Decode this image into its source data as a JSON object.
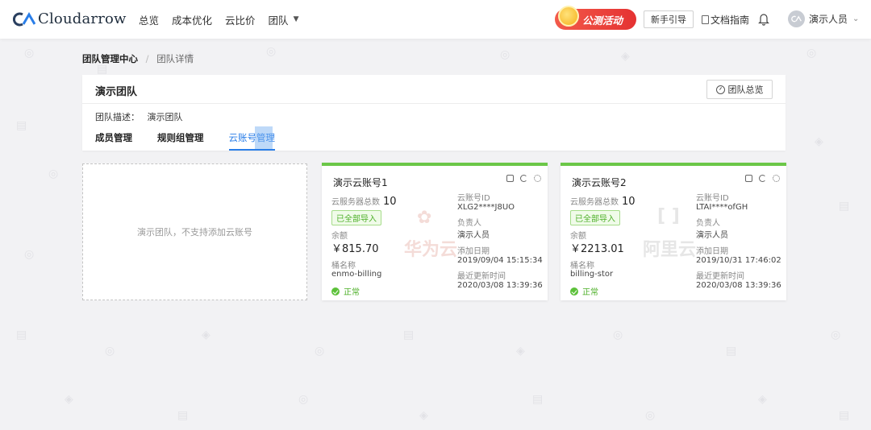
{
  "brand": {
    "name": "Cloudarrow",
    "accent": "#2a7ee8",
    "green": "#6bc748"
  },
  "nav": {
    "items": [
      "总览",
      "成本优化",
      "云比价",
      "团队"
    ]
  },
  "header": {
    "promo_label": "公测活动",
    "guide_label": "新手引导",
    "docs_label": "文档指南",
    "user_name": "演示人员"
  },
  "breadcrumb": {
    "root": "团队管理中心",
    "separator": "/",
    "current": "团队详情"
  },
  "team": {
    "name": "演示团队",
    "overview_label": "团队总览",
    "desc_label": "团队描述：",
    "desc_value": "演示团队",
    "tabs": [
      "成员管理",
      "规则组管理",
      "云账号管理"
    ],
    "active_tab": "云账号管理"
  },
  "add_account": {
    "message": "演示团队，不支持添加云账号"
  },
  "labels": {
    "server_count": "云服务器总数",
    "balance": "余额",
    "bucket": "桶名称",
    "account_id": "云账号ID",
    "owner": "负责人",
    "added": "添加日期",
    "updated": "最近更新时间"
  },
  "accounts": [
    {
      "title": "演示云账号1",
      "server_count": "10",
      "import_tag": "已全部导入",
      "balance": "￥815.70",
      "bucket": "enmo-billing",
      "status": "正常",
      "account_id": "XLG2****J8UO",
      "owner": "演示人员",
      "added": "2019/09/04 15:15:34",
      "updated": "2020/03/08 13:39:36",
      "watermark": "华为云"
    },
    {
      "title": "演示云账号2",
      "server_count": "10",
      "import_tag": "已全部导入",
      "balance": "￥2213.01",
      "bucket": "billing-stor",
      "status": "正常",
      "account_id": "LTAI****ofGH",
      "owner": "演示人员",
      "added": "2019/10/31 17:46:02",
      "updated": "2020/03/08 13:39:36",
      "watermark": "阿里云"
    }
  ]
}
